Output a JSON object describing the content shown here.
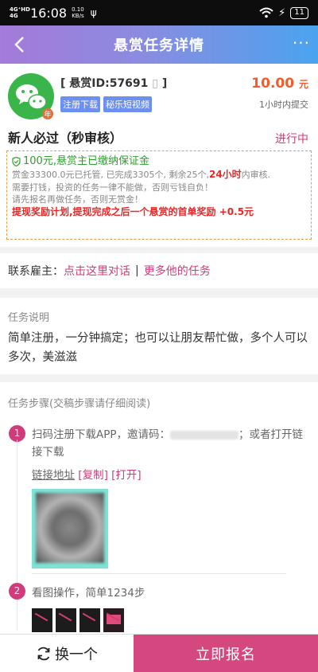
{
  "statusbar": {
    "network": "4G⁺HD",
    "network2": "4G",
    "time": "16:08",
    "speed_value": "0.10",
    "speed_unit": "KB/s",
    "battery": "11"
  },
  "header": {
    "title": "悬赏任务详情",
    "more": "···"
  },
  "task": {
    "id_text": "[ 悬赏ID:57691",
    "id_close": "]",
    "tags": [
      "注册下载",
      "秘乐短视频"
    ],
    "price": "10.00",
    "price_unit": "元",
    "submit_time": "1小时内提交",
    "logo_badge": "年",
    "title": "新人必过（秒审核）",
    "state": "进行中"
  },
  "notice": {
    "guarantee": "100元,悬赏主已缴纳保证金",
    "line1_pre": "赏金33300.0元已托管, 已完成3305个, 剩余25个,",
    "line1_hot": "24小时",
    "line1_post": "内审核.",
    "line2": "需要打钱，投资的任务一律不能做，否则亏钱自负！",
    "line3": "请先报名再做任务，否则无赏金！",
    "line4": "提现奖励计划,提现完成之后一个悬赏的首单奖励 +0.5元"
  },
  "contact": {
    "label": "联系雇主：",
    "chat_link": "点击这里对话",
    "separator": "|",
    "more_link": "更多他的任务"
  },
  "description": {
    "label": "任务说明",
    "text": "简单注册，一分钟搞定；也可以让朋友帮忙做，多个人可以多次，美滋滋"
  },
  "steps": {
    "label": "任务步骤(交稿步骤请仔细阅读)",
    "items": [
      {
        "num": "1",
        "text_pre": "扫码注册下载APP，邀请码：",
        "text_post": "；或者打开链接下载",
        "link_label": "链接地址",
        "copy": "[复制]",
        "open": "[打开]"
      },
      {
        "num": "2",
        "text": "看图操作，简单1234步"
      }
    ]
  },
  "bottom": {
    "switch_label": "换一个",
    "signup_label": "立即报名"
  }
}
